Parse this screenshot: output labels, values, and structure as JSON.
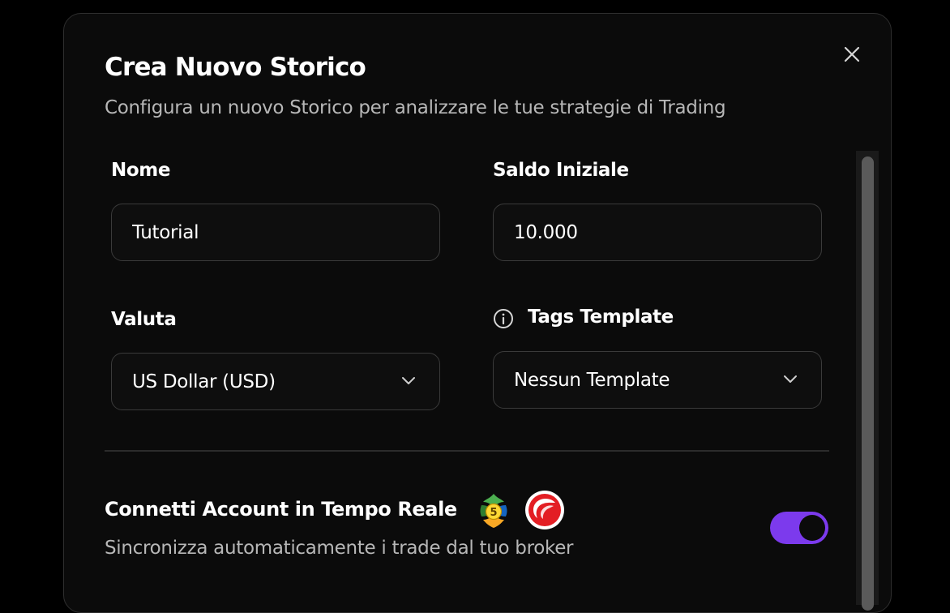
{
  "dialog": {
    "title": "Crea Nuovo Storico",
    "subtitle": "Configura un nuovo Storico per analizzare le tue strategie di Trading",
    "close_icon": "close-icon"
  },
  "form": {
    "name": {
      "label": "Nome",
      "value": "Tutorial"
    },
    "initial_balance": {
      "label": "Saldo Iniziale",
      "value": "10.000"
    },
    "currency": {
      "label": "Valuta",
      "selected": "US Dollar (USD)",
      "icon": "chevron-down-icon"
    },
    "tags_template": {
      "label": "Tags Template",
      "selected": "Nessun Template",
      "info_icon": "info-icon",
      "icon": "chevron-down-icon"
    }
  },
  "live_connection": {
    "title": "Connetti Account in Tempo Reale",
    "subtitle": "Sincronizza automaticamente i trade dal tuo broker",
    "logos": [
      "metatrader5-logo",
      "ctrader-logo"
    ],
    "enabled": true
  },
  "colors": {
    "accent": "#7c3aed",
    "background": "#0b0b0b",
    "border": "#3a3a3a",
    "muted_text": "#b7b7b7"
  }
}
